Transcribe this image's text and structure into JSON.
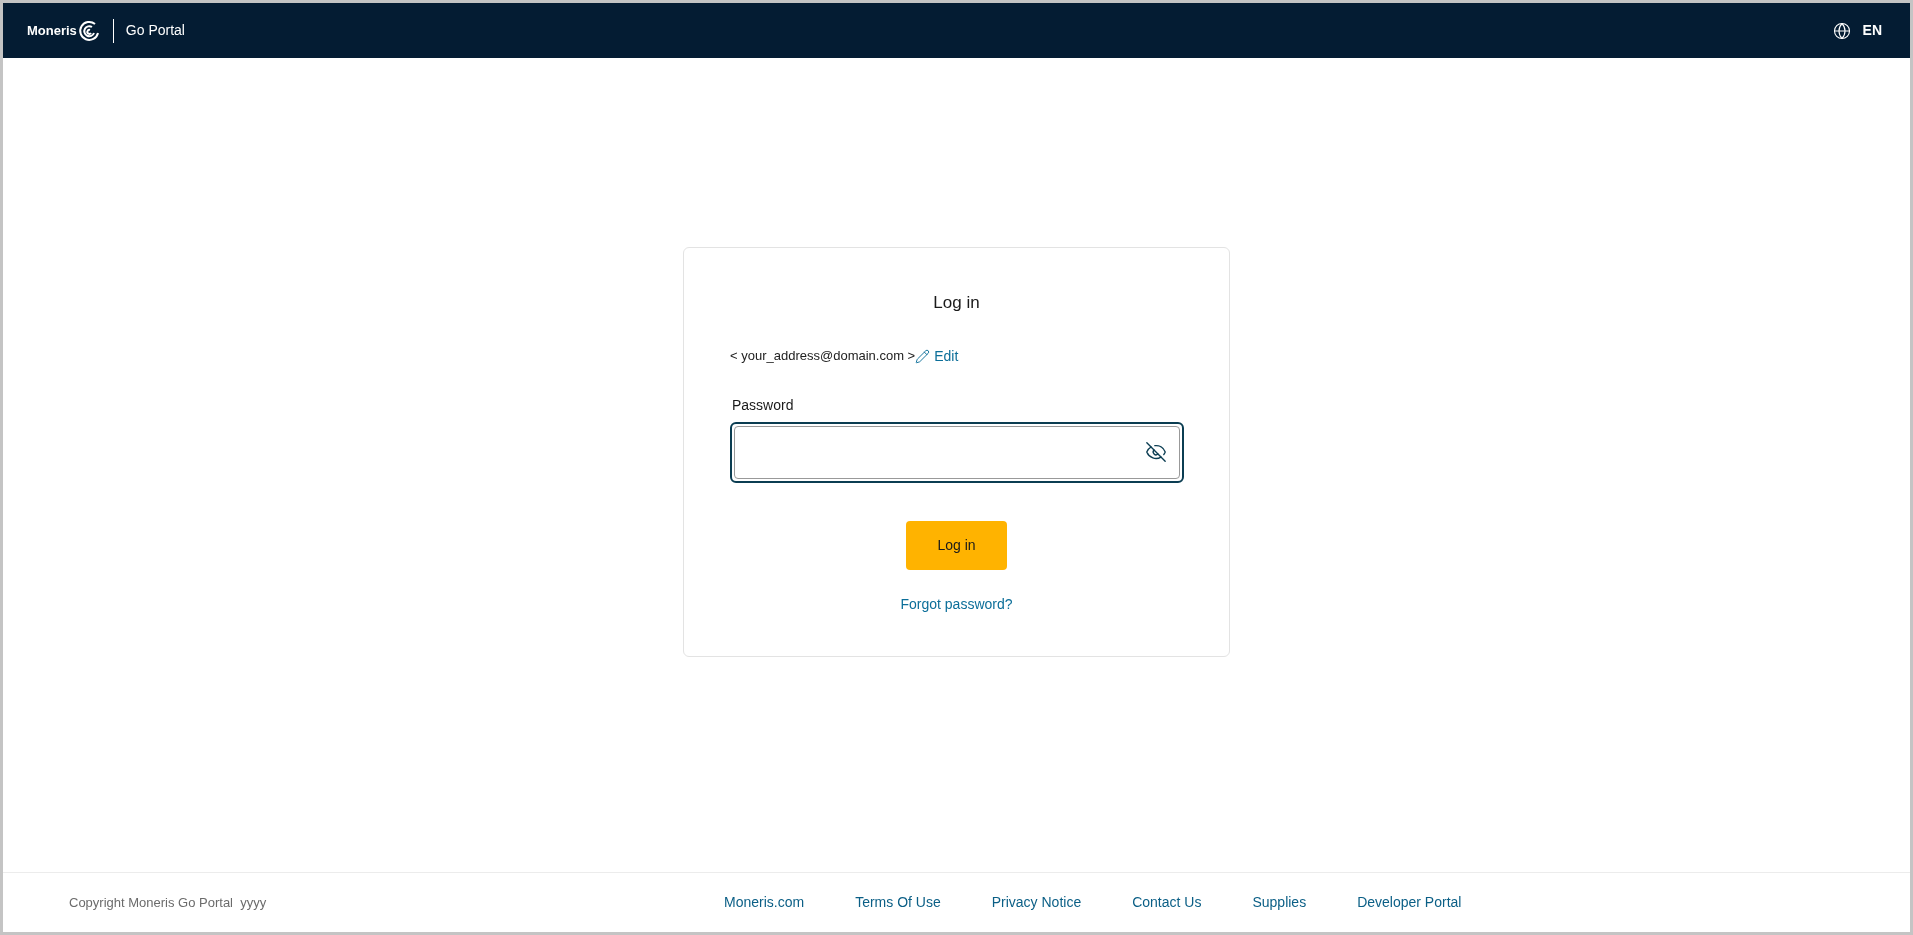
{
  "header": {
    "logo": "Moneris",
    "product": "Go Portal",
    "language": "EN"
  },
  "login": {
    "title": "Log in",
    "email": "< your_address@domain.com >",
    "edit_link": "Edit",
    "password_label": "Password",
    "password_visible": false,
    "submit": "Log in",
    "forgot_link": "Forgot password?"
  },
  "footer": {
    "copyright": "Copyright Moneris Go Portal  yyyy",
    "links": [
      "Moneris.com",
      "Terms Of Use",
      "Privacy Notice",
      "Contact Us",
      "Supplies",
      "Developer Portal"
    ]
  }
}
